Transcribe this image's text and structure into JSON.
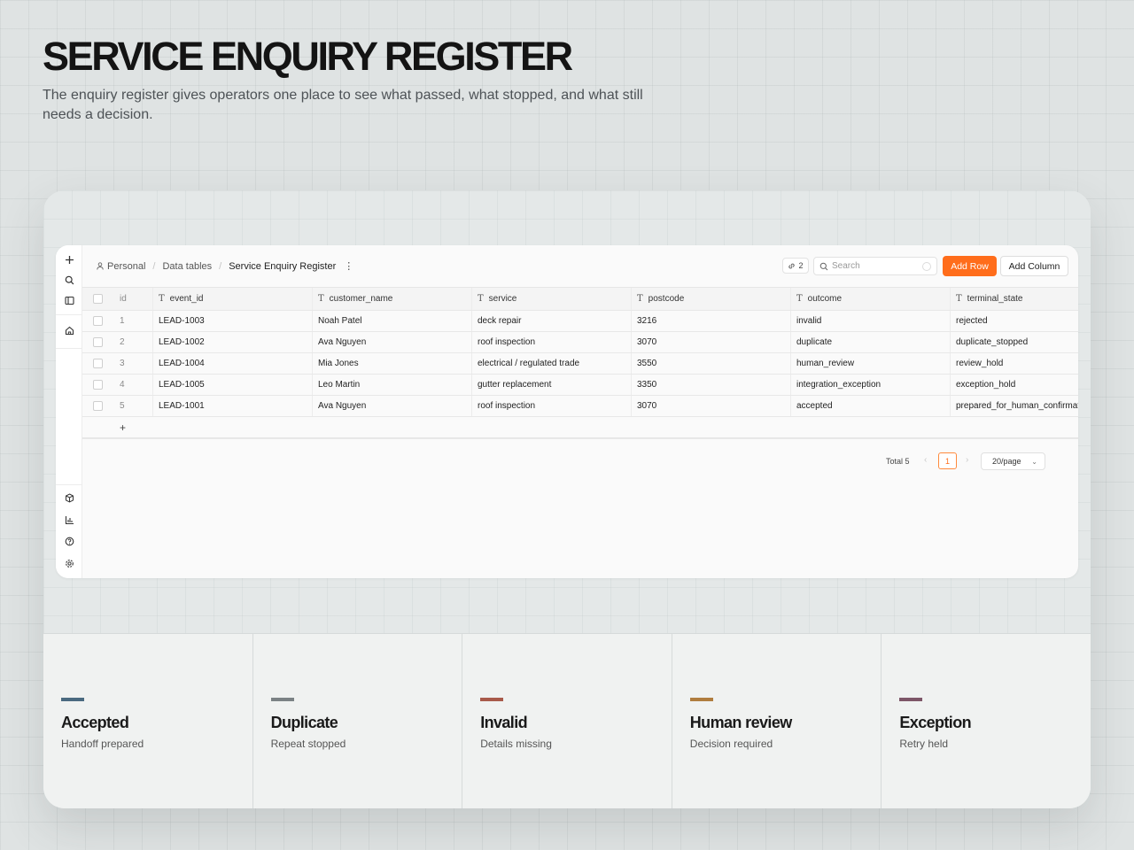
{
  "hero": {
    "title": "SERVICE ENQUIRY REGISTER",
    "subtitle": "The enquiry register gives operators one place to see what passed, what stopped, and what still needs a decision."
  },
  "rail": {
    "top_icons": [
      "plus-icon",
      "search-icon",
      "sidebar-icon",
      "home-icon"
    ],
    "bottom_icons": [
      "cube-icon",
      "chart-icon",
      "help-icon",
      "settings-icon"
    ]
  },
  "breadcrumb": {
    "personal": "Personal",
    "data_tables": "Data tables",
    "current": "Service Enquiry Register"
  },
  "toolbar": {
    "link_count": "2",
    "search_placeholder": "Search",
    "add_row": "Add Row",
    "add_column": "Add Column",
    "accent": "#ff6d1b"
  },
  "table": {
    "columns": [
      "id",
      "event_id",
      "customer_name",
      "service",
      "postcode",
      "outcome",
      "terminal_state"
    ],
    "rows": [
      [
        "1",
        "LEAD-1003",
        "Noah Patel",
        "deck repair",
        "3216",
        "invalid",
        "rejected"
      ],
      [
        "2",
        "LEAD-1002",
        "Ava Nguyen",
        "roof inspection",
        "3070",
        "duplicate",
        "duplicate_stopped"
      ],
      [
        "3",
        "LEAD-1004",
        "Mia Jones",
        "electrical / regulated trade",
        "3550",
        "human_review",
        "review_hold"
      ],
      [
        "4",
        "LEAD-1005",
        "Leo Martin",
        "gutter replacement",
        "3350",
        "integration_exception",
        "exception_hold"
      ],
      [
        "5",
        "LEAD-1001",
        "Ava Nguyen",
        "roof inspection",
        "3070",
        "accepted",
        "prepared_for_human_confirmat"
      ]
    ],
    "add_row_symbol": "+"
  },
  "pagination": {
    "total": "Total 5",
    "current_page": "1",
    "per_page": "20/page"
  },
  "legend": [
    {
      "title": "Accepted",
      "subtitle": "Handoff prepared",
      "color": "#4a6a80"
    },
    {
      "title": "Duplicate",
      "subtitle": "Repeat stopped",
      "color": "#7b8285"
    },
    {
      "title": "Invalid",
      "subtitle": "Details missing",
      "color": "#a85a4a"
    },
    {
      "title": "Human review",
      "subtitle": "Decision required",
      "color": "#b07d3f"
    },
    {
      "title": "Exception",
      "subtitle": "Retry held",
      "color": "#7d5668"
    }
  ]
}
